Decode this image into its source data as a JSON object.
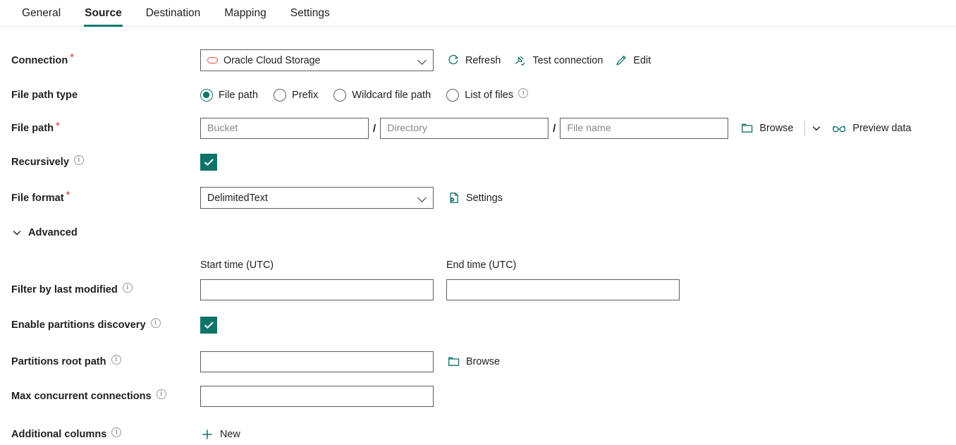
{
  "tabs": [
    {
      "label": "General",
      "active": false
    },
    {
      "label": "Source",
      "active": true
    },
    {
      "label": "Destination",
      "active": false
    },
    {
      "label": "Mapping",
      "active": false
    },
    {
      "label": "Settings",
      "active": false
    }
  ],
  "accent_color": "#0f7368",
  "required_color": "#d13438",
  "oracle_icon_color": "#e8543f",
  "connection": {
    "label": "Connection",
    "required": true,
    "value": "Oracle Cloud Storage",
    "icon": "oracle-logo-icon",
    "actions": [
      {
        "label": "Refresh",
        "icon": "refresh-icon"
      },
      {
        "label": "Test connection",
        "icon": "plug-check-icon"
      },
      {
        "label": "Edit",
        "icon": "pencil-icon"
      }
    ]
  },
  "file_path_type": {
    "label": "File path type",
    "options": [
      {
        "label": "File path",
        "selected": true,
        "info": false
      },
      {
        "label": "Prefix",
        "selected": false,
        "info": false
      },
      {
        "label": "Wildcard file path",
        "selected": false,
        "info": false
      },
      {
        "label": "List of files",
        "selected": false,
        "info": true
      }
    ]
  },
  "file_path": {
    "label": "File path",
    "required": true,
    "bucket_placeholder": "Bucket",
    "bucket_value": "",
    "directory_placeholder": "Directory",
    "directory_value": "",
    "filename_placeholder": "File name",
    "filename_value": "",
    "separator": "/",
    "browse_label": "Browse",
    "browse_icon": "folder-icon",
    "dropdown_icon": "chevron-down-icon",
    "preview_label": "Preview data",
    "preview_icon": "glasses-icon"
  },
  "recursively": {
    "label": "Recursively",
    "info": true,
    "checked": true
  },
  "file_format": {
    "label": "File format",
    "required": true,
    "value": "DelimitedText",
    "settings_label": "Settings",
    "settings_icon": "file-gear-icon"
  },
  "advanced": {
    "label": "Advanced",
    "expanded": true,
    "icon": "chevron-down-icon"
  },
  "filter_by_last_modified": {
    "label": "Filter by last modified",
    "info": true,
    "start_label": "Start time (UTC)",
    "start_value": "",
    "end_label": "End time (UTC)",
    "end_value": ""
  },
  "enable_partitions_discovery": {
    "label": "Enable partitions discovery",
    "info": true,
    "checked": true
  },
  "partitions_root_path": {
    "label": "Partitions root path",
    "info": true,
    "value": "",
    "browse_label": "Browse",
    "browse_icon": "folder-icon"
  },
  "max_concurrent_connections": {
    "label": "Max concurrent connections",
    "info": true,
    "value": ""
  },
  "additional_columns": {
    "label": "Additional columns",
    "info": true,
    "new_label": "New",
    "new_icon": "plus-icon"
  }
}
